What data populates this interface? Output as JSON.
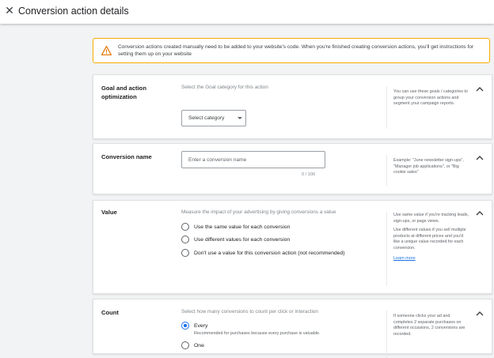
{
  "header": {
    "close_icon": "close-icon",
    "title": "Conversion action details"
  },
  "alert": {
    "icon": "warning-icon",
    "icon_color": "#e37400",
    "border_color": "#f9ab00",
    "text": "Conversion actions created manually need to be added to your website's code. When you're finished creating conversion actions, you'll get instructions for setting them up on your website"
  },
  "sections": {
    "goal": {
      "label_line1": "Goal and action",
      "label_line2": "optimization",
      "description": "Select the Goal category for this action",
      "dropdown_value": "Select category",
      "help": "You can use these goals / categories to group your conversion actions and segment your campaign reports."
    },
    "conversion_name": {
      "label": "Conversion name",
      "placeholder": "Enter a conversion name",
      "value": "",
      "counter": "0 / 100",
      "help": "Example: \"June newsletter sign-ups\", \"Manager job applications\", or \"Big cookie sales\""
    },
    "value": {
      "label": "Value",
      "description": "Measure the impact of your advertising by giving conversions a value",
      "options": [
        "Use the same value for each conversion",
        "Use different values for each conversion",
        "Don't use a value for this conversion action (not recommended)"
      ],
      "help_p1": "Use same value if you're tracking leads, sign-ups, or page views.",
      "help_p2": "Use different values if you sell multiple products at different prices and you'd like a unique value recorded for each conversion.",
      "learn_more": "Learn more"
    },
    "count": {
      "label": "Count",
      "description": "Select how many conversions to count per click or interaction",
      "option_every": "Every",
      "option_every_sub": "Recommended for purchases because every purchase is valuable.",
      "option_one": "One",
      "selected": "Every",
      "help": "If someone clicks your ad and completes 2 separate purchases on different occasions, 2 conversions are recorded."
    }
  },
  "colors": {
    "accent": "#1a73e8",
    "background": "#f1f3f4"
  }
}
